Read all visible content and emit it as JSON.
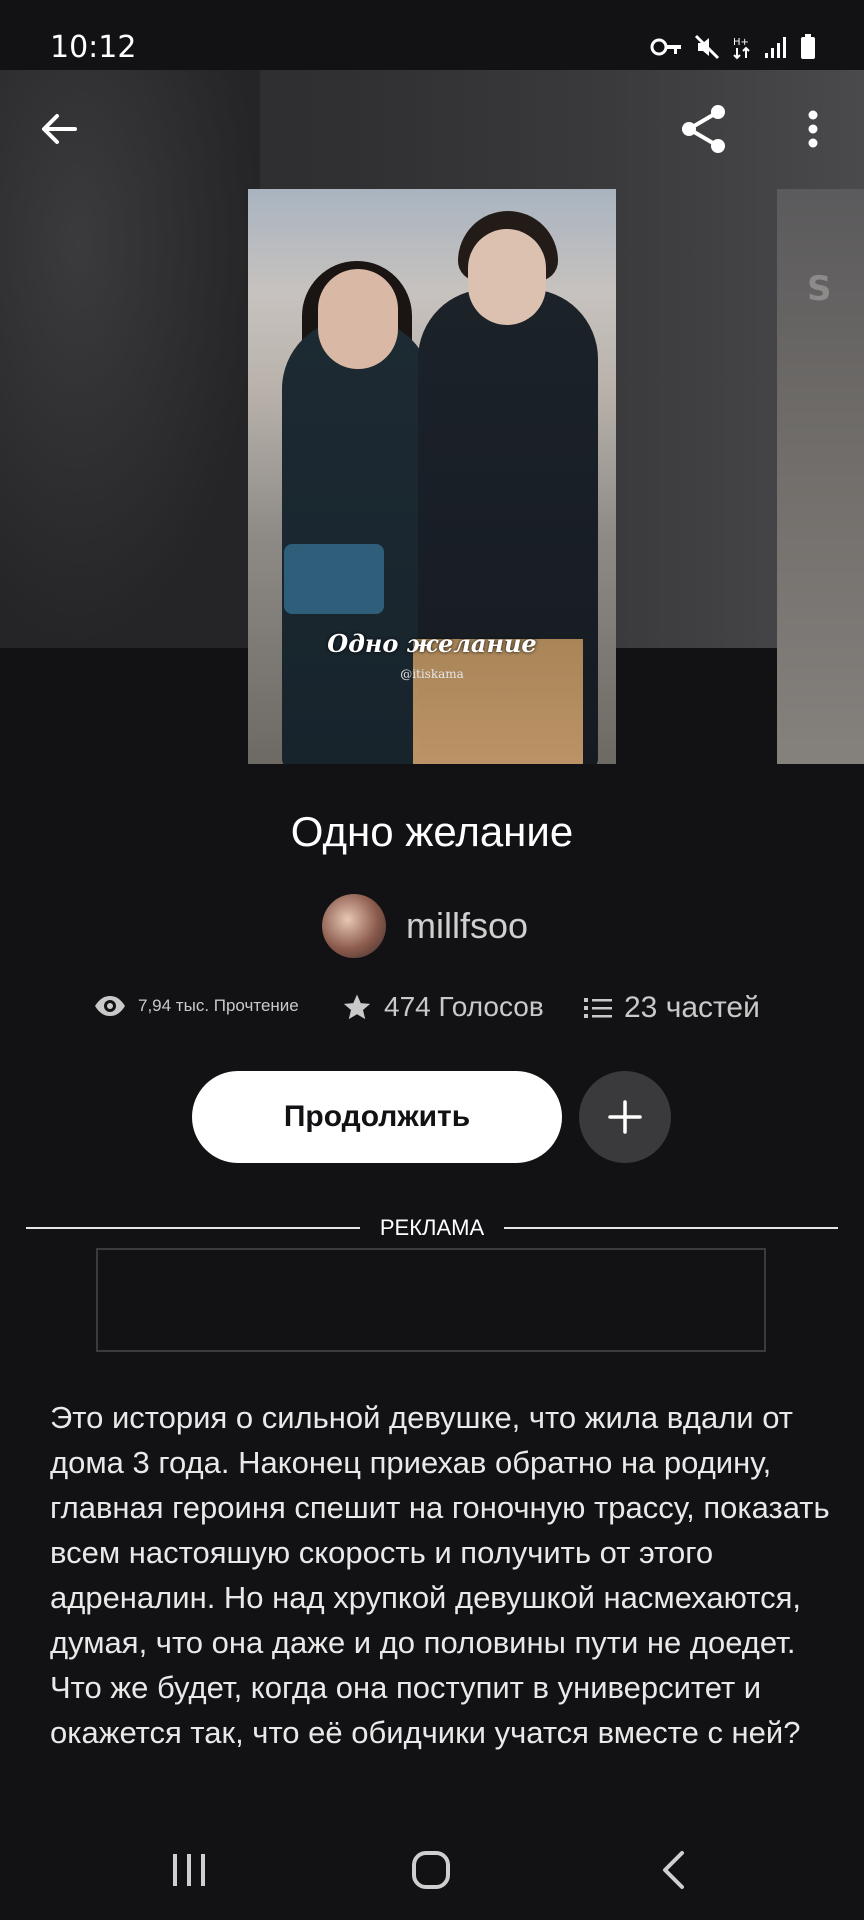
{
  "status_bar": {
    "time": "10:12"
  },
  "story": {
    "title": "Одно желание",
    "cover_title": "Одно желание",
    "cover_credit": "@itiskama",
    "next_cover_fragment": "S"
  },
  "author": {
    "name": "millfsoo"
  },
  "stats": {
    "reads": "7,94 тыс. Прочтение",
    "votes": "474 Голосов",
    "parts": "23 частей"
  },
  "actions": {
    "continue_label": "Продолжить"
  },
  "ad": {
    "label": "РЕКЛАМА"
  },
  "description": "Это история о сильной девушке, что жила вдали от дома 3 года. Наконец приехав обратно на родину, главная героиня спешит на гоночную трассу, показать всем настояшую скорость и получить от этого адреналин. Но над хрупкой девушкой насмехаются, думая, что она даже и до половины пути не доедет. Что же будет, когда она поступит в университет и окажется так, что её обидчики учатся вместе с ней?",
  "colors": {
    "background": "#121114",
    "button": "#ffffff",
    "add_button": "#3a393c"
  }
}
